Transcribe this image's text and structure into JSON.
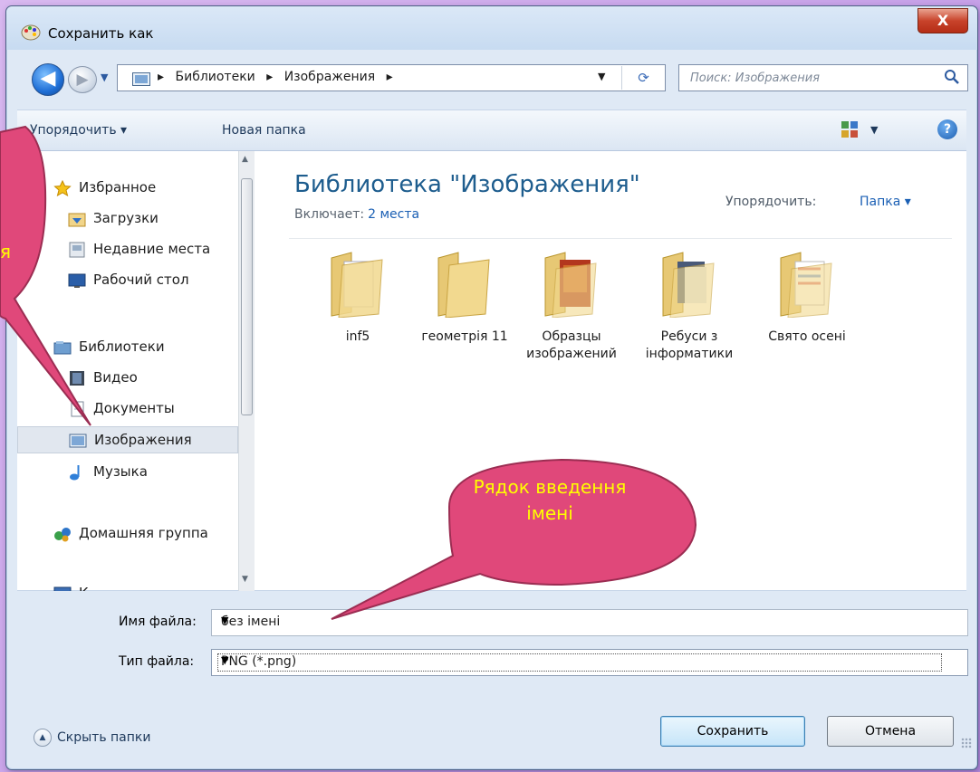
{
  "window": {
    "title": "Сохранить как",
    "close_label": "X"
  },
  "nav": {
    "back_label": "◀",
    "forward_label": "▶",
    "breadcrumbs": [
      "Библиотеки",
      "Изображения"
    ],
    "crumb_separator": "▸",
    "search_placeholder": "Поиск: Изображения"
  },
  "toolbar": {
    "organize_label": "Упорядочить ▾",
    "new_folder_label": "Новая папка",
    "help_label": "?"
  },
  "sidebar": {
    "items": [
      {
        "label": "Избранное",
        "icon": "star-icon"
      },
      {
        "label": "Загрузки",
        "icon": "downloads-icon"
      },
      {
        "label": "Недавние места",
        "icon": "recent-places-icon"
      },
      {
        "label": "Рабочий стол",
        "icon": "desktop-icon"
      },
      {
        "label": "Библиотеки",
        "icon": "libraries-icon"
      },
      {
        "label": "Видео",
        "icon": "video-icon"
      },
      {
        "label": "Документы",
        "icon": "documents-icon"
      },
      {
        "label": "Изображения",
        "icon": "pictures-icon"
      },
      {
        "label": "Музыка",
        "icon": "music-icon"
      },
      {
        "label": "Домашняя группа",
        "icon": "homegroup-icon"
      },
      {
        "label": "К",
        "icon": "computer-icon"
      }
    ],
    "selected": "Изображения"
  },
  "library": {
    "title": "Библиотека \"Изображения\"",
    "includes_label": "Включает:",
    "includes_link": "2 места",
    "arrange_label": "Упорядочить:",
    "arrange_value": "Папка ▾"
  },
  "folders": [
    {
      "name": "inf5"
    },
    {
      "name": "геометрія 11"
    },
    {
      "name": "Образцы изображений"
    },
    {
      "name": "Ребуси з інформатики"
    },
    {
      "name": "Свято осені"
    }
  ],
  "file": {
    "name_label": "Имя файла:",
    "name_value": "без імені",
    "type_label": "Тип файла:",
    "type_value": "PNG (*.png)"
  },
  "footer": {
    "hide_folders_label": "Скрыть папки",
    "save_label": "Сохранить",
    "cancel_label": "Отмена"
  },
  "callouts": {
    "main_text": "Рядок введення імені",
    "left_partial_text": "я",
    "color": "#e0487a",
    "text_color": "#ffff00"
  }
}
